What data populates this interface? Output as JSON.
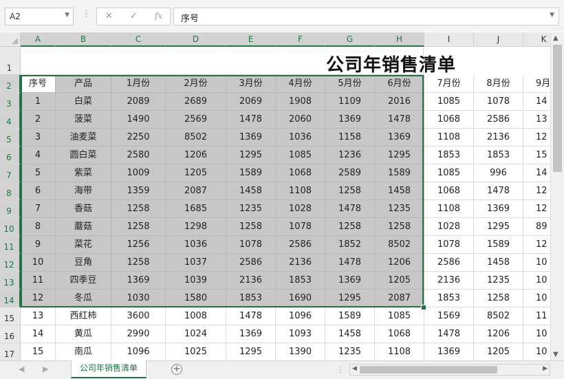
{
  "name_box": {
    "value": "A2"
  },
  "formula_bar": {
    "value": "序号",
    "cancel_icon": "✕",
    "enter_icon": "✓",
    "fx_label": "fx"
  },
  "columns": [
    "A",
    "B",
    "C",
    "D",
    "E",
    "F",
    "G",
    "H",
    "I",
    "J",
    "K"
  ],
  "row_numbers": [
    "1",
    "2",
    "3",
    "4",
    "5",
    "6",
    "7",
    "8",
    "9",
    "10",
    "11",
    "12",
    "13",
    "14",
    "15",
    "16",
    "17"
  ],
  "title": "公司年销售清单",
  "headers": [
    "序号",
    "产品",
    "1月份",
    "2月份",
    "3月份",
    "4月份",
    "5月份",
    "6月份",
    "7月份",
    "8月份",
    "9月"
  ],
  "rows": [
    [
      "1",
      "白菜",
      "2089",
      "2689",
      "2069",
      "1908",
      "1109",
      "2016",
      "1085",
      "1078",
      "14"
    ],
    [
      "2",
      "菠菜",
      "1490",
      "2569",
      "1478",
      "2060",
      "1369",
      "1478",
      "1068",
      "2586",
      "13"
    ],
    [
      "3",
      "油麦菜",
      "2250",
      "8502",
      "1369",
      "1036",
      "1158",
      "1369",
      "1108",
      "2136",
      "12"
    ],
    [
      "4",
      "圆白菜",
      "2580",
      "1206",
      "1295",
      "1085",
      "1236",
      "1295",
      "1853",
      "1853",
      "15"
    ],
    [
      "5",
      "紫菜",
      "1009",
      "1205",
      "1589",
      "1068",
      "2589",
      "1589",
      "1085",
      "996",
      "14"
    ],
    [
      "6",
      "海带",
      "1359",
      "2087",
      "1458",
      "1108",
      "1258",
      "1458",
      "1068",
      "1478",
      "12"
    ],
    [
      "7",
      "香菇",
      "1258",
      "1685",
      "1235",
      "1028",
      "1478",
      "1235",
      "1108",
      "1369",
      "12"
    ],
    [
      "8",
      "蘑菇",
      "1258",
      "1298",
      "1258",
      "1078",
      "1258",
      "1258",
      "1028",
      "1295",
      "89"
    ],
    [
      "9",
      "菜花",
      "1256",
      "1036",
      "1078",
      "2586",
      "1852",
      "8502",
      "1078",
      "1589",
      "12"
    ],
    [
      "10",
      "豆角",
      "1258",
      "1037",
      "2586",
      "2136",
      "1478",
      "1206",
      "2586",
      "1458",
      "10"
    ],
    [
      "11",
      "四季豆",
      "1369",
      "1039",
      "2136",
      "1853",
      "1369",
      "1205",
      "2136",
      "1235",
      "10"
    ],
    [
      "12",
      "冬瓜",
      "1030",
      "1580",
      "1853",
      "1690",
      "1295",
      "2087",
      "1853",
      "1258",
      "10"
    ],
    [
      "13",
      "西红柿",
      "3600",
      "1008",
      "1478",
      "1096",
      "1589",
      "1085",
      "1569",
      "8502",
      "11"
    ],
    [
      "14",
      "黄瓜",
      "2990",
      "1024",
      "1369",
      "1093",
      "1458",
      "1068",
      "1478",
      "1206",
      "10"
    ],
    [
      "15",
      "南瓜",
      "1096",
      "1025",
      "1295",
      "1390",
      "1235",
      "1108",
      "1369",
      "1205",
      "10"
    ]
  ],
  "sheet_tab": {
    "label": "公司年销售清单"
  },
  "add_sheet_icon": "+",
  "colors": {
    "accent": "#217346",
    "selection_fill": "#c7c7c7",
    "header_fill": "#e9e9e9"
  }
}
